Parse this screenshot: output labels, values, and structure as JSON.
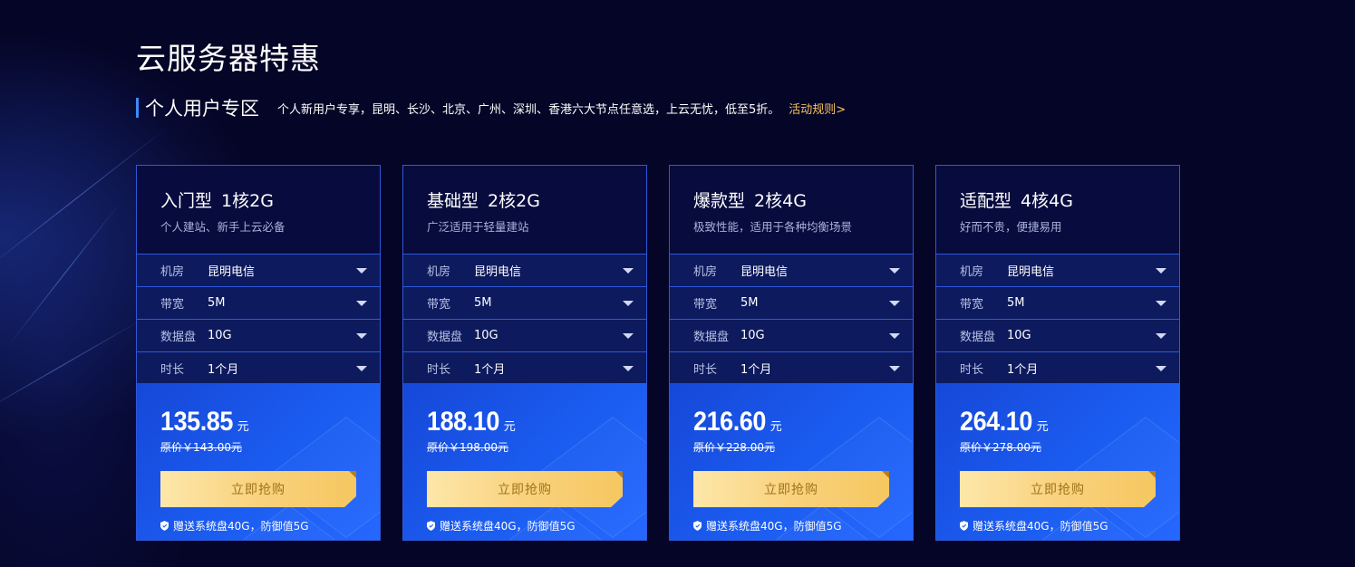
{
  "page": {
    "title": "云服务器特惠"
  },
  "section": {
    "title": "个人用户专区",
    "desc": "个人新用户专享，昆明、长沙、北京、广州、深圳、香港六大节点任意选，上云无忧，低至5折。",
    "rules_link": "活动规则>"
  },
  "colors": {
    "accent": "#3d8bff",
    "card_border": "#2f58d8",
    "link": "#f6c35b",
    "button": "#f9d27e"
  },
  "cards": [
    {
      "name": "入门型",
      "spec": "1核2G",
      "desc": "个人建站、新手上云必备",
      "options": [
        {
          "label": "机房",
          "value": "昆明电信"
        },
        {
          "label": "带宽",
          "value": "5M"
        },
        {
          "label": "数据盘",
          "value": "10G"
        },
        {
          "label": "时长",
          "value": "1个月"
        }
      ],
      "price": "135.85",
      "unit": "元",
      "original": "原价￥143.00元",
      "button": "立即抢购",
      "gift": "赠送系统盘40G，防御值5G"
    },
    {
      "name": "基础型",
      "spec": "2核2G",
      "desc": "广泛适用于轻量建站",
      "options": [
        {
          "label": "机房",
          "value": "昆明电信"
        },
        {
          "label": "带宽",
          "value": "5M"
        },
        {
          "label": "数据盘",
          "value": "10G"
        },
        {
          "label": "时长",
          "value": "1个月"
        }
      ],
      "price": "188.10",
      "unit": "元",
      "original": "原价￥198.00元",
      "button": "立即抢购",
      "gift": "赠送系统盘40G，防御值5G"
    },
    {
      "name": "爆款型",
      "spec": "2核4G",
      "desc": "极致性能，适用于各种均衡场景",
      "options": [
        {
          "label": "机房",
          "value": "昆明电信"
        },
        {
          "label": "带宽",
          "value": "5M"
        },
        {
          "label": "数据盘",
          "value": "10G"
        },
        {
          "label": "时长",
          "value": "1个月"
        }
      ],
      "price": "216.60",
      "unit": "元",
      "original": "原价￥228.00元",
      "button": "立即抢购",
      "gift": "赠送系统盘40G，防御值5G"
    },
    {
      "name": "适配型",
      "spec": "4核4G",
      "desc": "好而不贵，便捷易用",
      "options": [
        {
          "label": "机房",
          "value": "昆明电信"
        },
        {
          "label": "带宽",
          "value": "5M"
        },
        {
          "label": "数据盘",
          "value": "10G"
        },
        {
          "label": "时长",
          "value": "1个月"
        }
      ],
      "price": "264.10",
      "unit": "元",
      "original": "原价￥278.00元",
      "button": "立即抢购",
      "gift": "赠送系统盘40G，防御值5G"
    }
  ]
}
